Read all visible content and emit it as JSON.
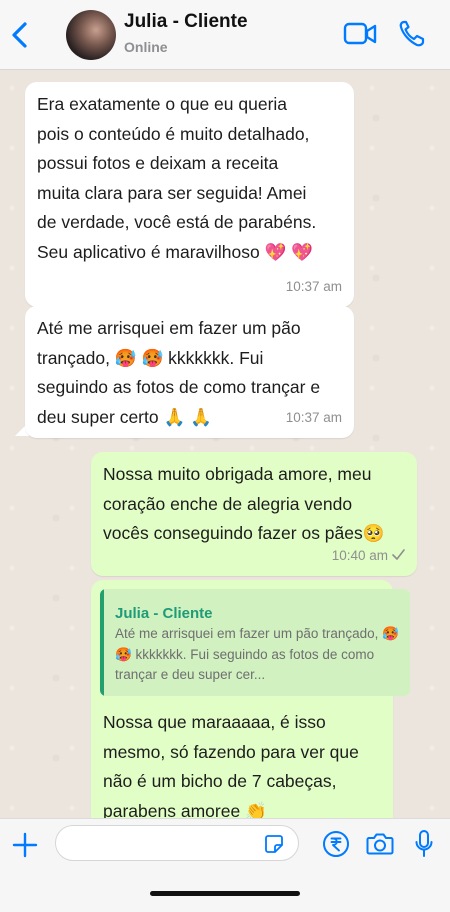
{
  "header": {
    "contact_name": "Julia - Cliente",
    "status": "Online"
  },
  "messages": [
    {
      "direction": "incoming",
      "lines": [
        " Era exatamente o que eu queria",
        "pois o conteúdo é muito detalhado,",
        "possui fotos e deixam a receita",
        "muita clara para ser seguida! Amei",
        "de verdade, você está de parabéns.",
        "Seu aplicativo é maravilhoso 💖 💖"
      ],
      "time": "10:37 am"
    },
    {
      "direction": "incoming",
      "lines": [
        " Até me arrisquei em fazer um pão",
        "trançado, 🥵 🥵  kkkkkkk. Fui",
        "seguindo as fotos de como trançar e",
        "deu super certo 🙏 🙏"
      ],
      "time": "10:37 am"
    },
    {
      "direction": "outgoing",
      "lines": [
        "Nossa muito obrigada amore, meu",
        "coração enche de alegria vendo",
        "vocês conseguindo fazer os pães🥺"
      ],
      "time": "10:40 am",
      "status_icon": "check-icon"
    },
    {
      "direction": "outgoing",
      "quote": {
        "author": "Julia - Cliente",
        "text": "Até me arrisquei em fazer um pão trançado, 🥵 🥵  kkkkkkk. Fui seguindo as fotos de como trançar e deu super cer..."
      },
      "lines": [
        "Nossa que maraaaaa, é isso",
        "mesmo, só fazendo para ver que",
        "não é um bicho de 7 cabeças,",
        "parabens amoree 👏"
      ]
    }
  ],
  "input": {
    "value": "",
    "placeholder": ""
  },
  "icons": {
    "back": "chevron-left-icon",
    "video": "video-camera-icon",
    "phone": "phone-icon",
    "attach": "plus-icon",
    "sticker": "sticker-icon",
    "payment": "rupee-icon",
    "camera": "camera-icon",
    "mic": "microphone-icon"
  },
  "colors": {
    "accent": "#007aff",
    "incoming_bubble": "#ffffff",
    "outgoing_bubble": "#e1fec6",
    "quote_name": "#1e9b77"
  }
}
